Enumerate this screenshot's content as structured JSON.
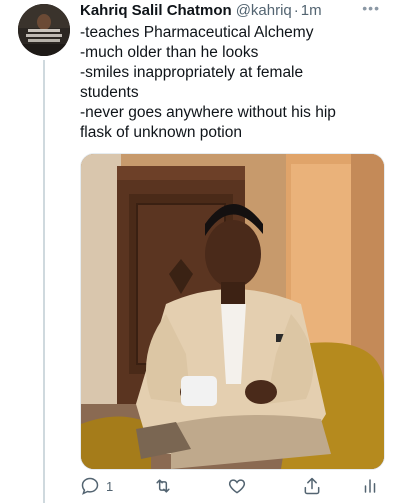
{
  "tweet": {
    "author_name": "Kahriq Salil Chatmon",
    "author_handle": "@kahriq",
    "separator": "·",
    "time": "1m",
    "lines": [
      "-teaches Pharmaceutical Alchemy",
      "-much older than he looks",
      "-smiles inappropriately at female",
      "students",
      "-never goes anywhere without his hip",
      "flask of unknown potion"
    ]
  },
  "actions": {
    "reply_count": "1"
  },
  "icons": {
    "more": "more-dots-icon",
    "reply": "reply-icon",
    "retweet": "retweet-icon",
    "like": "heart-icon",
    "share": "share-icon",
    "analytics": "analytics-icon"
  },
  "colors": {
    "icon_gray": "#536471",
    "thread_line": "#cfd9de"
  }
}
